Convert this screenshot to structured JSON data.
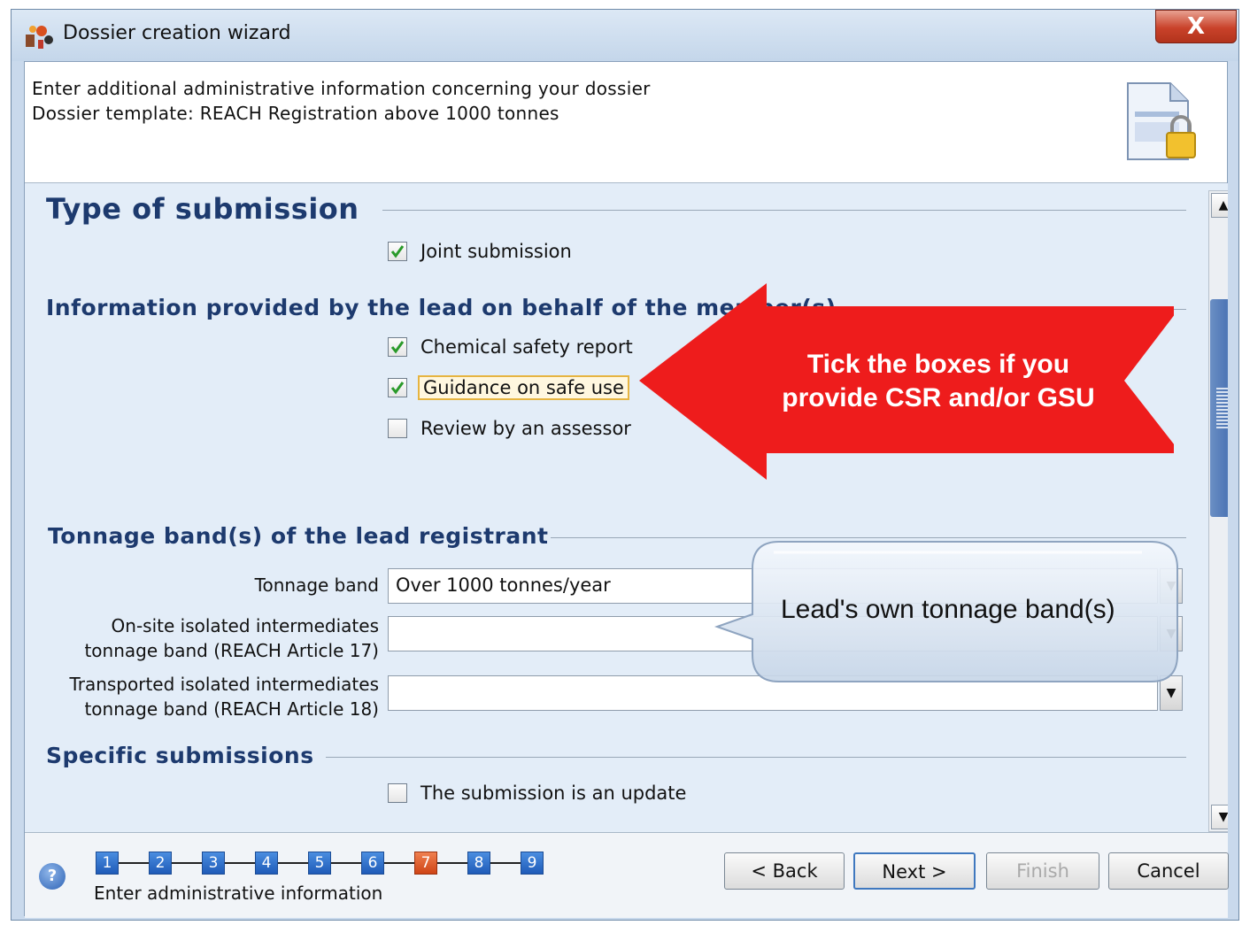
{
  "window": {
    "title": "Dossier creation wizard",
    "close_label": "X"
  },
  "header": {
    "line1": "Enter additional administrative information concerning your dossier",
    "line2": "Dossier template: REACH Registration above 1000 tonnes",
    "icon": "locked-document-icon"
  },
  "sections": {
    "type_of_submission": {
      "title": "Type of submission",
      "joint_submission": {
        "label": "Joint submission",
        "checked": true
      }
    },
    "lead_info": {
      "title": "Information provided by the lead on behalf of the member(s)",
      "chemical_safety_report": {
        "label": "Chemical safety report",
        "checked": true
      },
      "guidance_on_safe_use": {
        "label": "Guidance on safe use",
        "checked": true
      },
      "review_by_assessor": {
        "label": "Review by an assessor",
        "checked": false
      }
    },
    "tonnage": {
      "title": "Tonnage band(s) of the lead registrant",
      "tonnage_band": {
        "label": "Tonnage band",
        "value": "Over 1000 tonnes/year"
      },
      "onsite": {
        "label_line1": "On-site isolated intermediates",
        "label_line2": "tonnage band (REACH Article 17)",
        "value": ""
      },
      "transported": {
        "label_line1": "Transported isolated intermediates",
        "label_line2": "tonnage band (REACH Article 18)",
        "value": ""
      }
    },
    "specific": {
      "title": "Specific submissions",
      "update": {
        "label": "The submission is an update",
        "checked": false
      }
    }
  },
  "footer": {
    "help_label": "?",
    "steps": [
      "1",
      "2",
      "3",
      "4",
      "5",
      "6",
      "7",
      "8",
      "9"
    ],
    "current_step": 7,
    "step_caption": "Enter administrative information",
    "buttons": {
      "back": "< Back",
      "next": "Next >",
      "finish": "Finish",
      "cancel": "Cancel"
    }
  },
  "annotations": {
    "arrow_line1": "Tick the boxes if you",
    "arrow_line2": "provide CSR and/or GSU",
    "bubble_text": "Lead's own tonnage band(s)",
    "arrow_color": "#ee1c1c"
  }
}
